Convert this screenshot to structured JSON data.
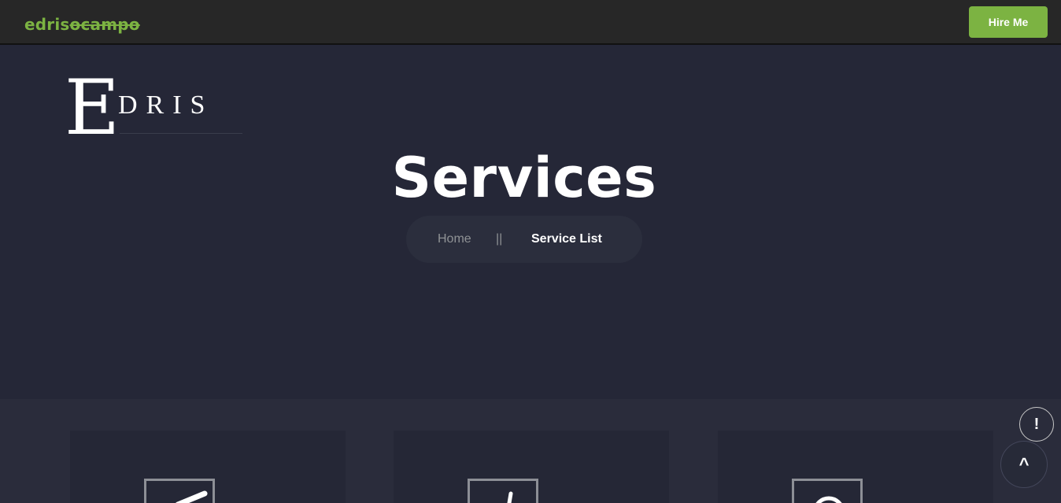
{
  "header": {
    "brand_first": "edris",
    "brand_second": "ocampo",
    "hire_label": "Hire Me",
    "accent_color": "#7cb342"
  },
  "logo": {
    "initial": "E",
    "word": "DRIS"
  },
  "hero": {
    "title": "Services"
  },
  "breadcrumb": {
    "home": "Home",
    "separator": "||",
    "current": "Service List"
  },
  "service_cards": [
    {
      "icon": "pen-icon"
    },
    {
      "icon": "brush-icon"
    },
    {
      "icon": "lightbulb-icon"
    }
  ],
  "floating": {
    "info_symbol": "!",
    "top_symbol": "^"
  }
}
